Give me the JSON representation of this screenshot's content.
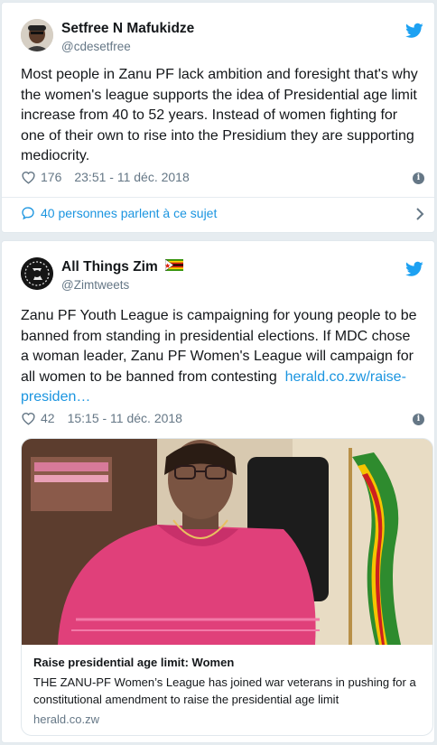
{
  "tweets": [
    {
      "author_name": "Setfree N Mafukidze",
      "handle": "@cdesetfree",
      "text": "Most people in Zanu PF lack ambition and foresight that's why the women's league supports the idea of Presidential age limit increase from 40 to 52 years. Instead of women fighting for one of their own to rise into the Presidium they are supporting mediocrity.",
      "likes": "176",
      "timestamp": "23:51 - 11 déc. 2018",
      "conversation_label": "40 personnes parlent à ce sujet",
      "icons": [
        "heart-icon",
        "info-icon",
        "twitter-bird-icon",
        "chat-bubble-icon",
        "chevron-right-icon"
      ]
    },
    {
      "author_name": "All Things Zim",
      "handle": "@Zimtweets",
      "text": "Zanu PF Youth League is campaigning for young people to be banned from standing in presidential elections. If MDC chose a woman leader, Zanu PF Women's League will campaign for all women to be banned from contesting",
      "link_text": "herald.co.zw/raise-presiden…",
      "likes": "42",
      "timestamp": "15:15 - 11 déc. 2018",
      "card": {
        "title": "Raise presidential age limit: Women",
        "description": "THE ZANU-PF Women’s League has joined war veterans in pushing for a constitutional amendment to raise the presidential age limit",
        "domain": "herald.co.zw"
      },
      "icons": [
        "heart-icon",
        "info-icon",
        "twitter-bird-icon",
        "zimbabwe-flag-icon"
      ]
    }
  ],
  "colors": {
    "link_blue": "#1b95e0",
    "secondary_gray": "#657786",
    "background": "#e6ecf0",
    "card_border": "#e1e8ed"
  }
}
